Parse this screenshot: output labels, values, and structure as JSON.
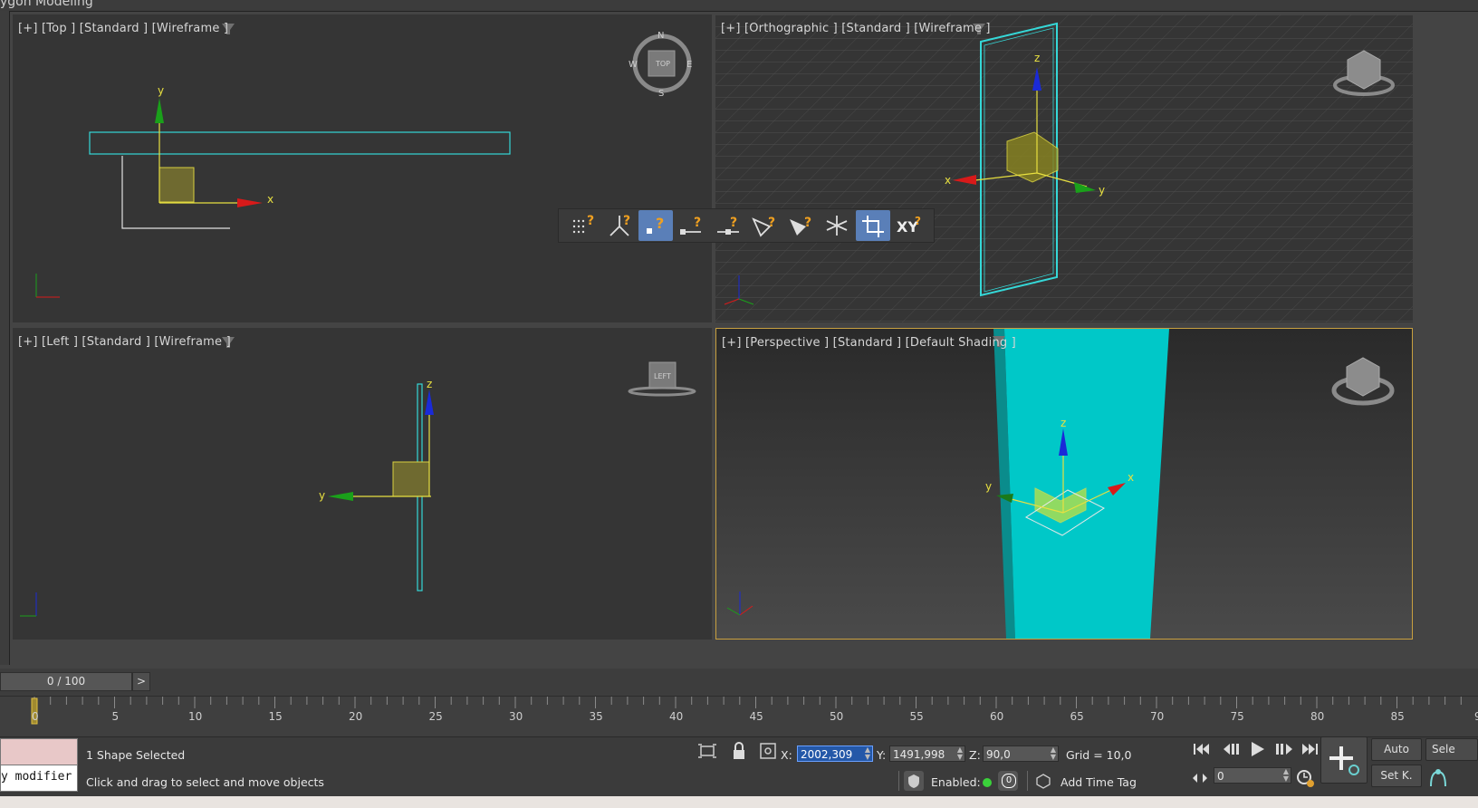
{
  "app": {
    "panel_title": "ygon Modeling"
  },
  "viewports": {
    "top": {
      "label": "[+] [Top ] [Standard ] [Wireframe ]",
      "viewcube": {
        "n": "N",
        "s": "S",
        "e": "E",
        "w": "W",
        "face": "TOP"
      }
    },
    "ortho": {
      "label": "[+] [Orthographic ] [Standard ] [Wireframe ]"
    },
    "left": {
      "label": "[+] [Left ] [Standard ] [Wireframe ]",
      "viewcube": {
        "face": "LEFT"
      }
    },
    "persp": {
      "label": "[+] [Perspective ] [Standard ] [Default Shading ]"
    }
  },
  "axes": {
    "x": "x",
    "y": "y",
    "z": "z"
  },
  "snap_toolbar": {
    "items": [
      "grid-points-snap",
      "pivot-snap",
      "vertex-snap",
      "endpoint-snap",
      "midpoint-snap",
      "edge-snap",
      "face-snap",
      "snap-to-frozen",
      "axis-constraints",
      "xy-plane-constraint"
    ],
    "active": [
      "vertex-snap",
      "axis-constraints"
    ],
    "xy_label": "XY"
  },
  "timeline": {
    "frame_display": "0 / 100",
    "next_label": ">",
    "current_frame": 0,
    "ticks": [
      "0",
      "5",
      "10",
      "15",
      "20",
      "25",
      "30",
      "35",
      "40",
      "45",
      "50",
      "55",
      "60",
      "65",
      "70",
      "75",
      "80",
      "85",
      "9"
    ]
  },
  "status": {
    "modifier_input": "y modifier",
    "selection": "1 Shape Selected",
    "prompt": "Click and drag to select and move objects",
    "x_label": "X:",
    "x_value": "2002,309",
    "y_label": "Y:",
    "y_value": "1491,998",
    "z_label": "Z:",
    "z_value": "90,0",
    "grid": "Grid = 10,0",
    "enabled_label": "Enabled:",
    "enabled_value": "0",
    "add_time_tag": "Add Time Tag",
    "frame_field": "0",
    "auto_label": "Auto",
    "setkey_label": "Set K.",
    "sele_label": "Sele"
  },
  "colors": {
    "viewport_bg": "#353535",
    "grid_line": "#444444",
    "selection_cyan": "#35d8d8",
    "object_cyan": "#00c8c8",
    "gizmo_yellow": "#e8e040",
    "axis_red": "#d81a1a",
    "axis_green": "#1aa01a",
    "axis_blue": "#1a2ad8",
    "active_border": "#c8a040",
    "active_button": "#5a7fb8"
  }
}
